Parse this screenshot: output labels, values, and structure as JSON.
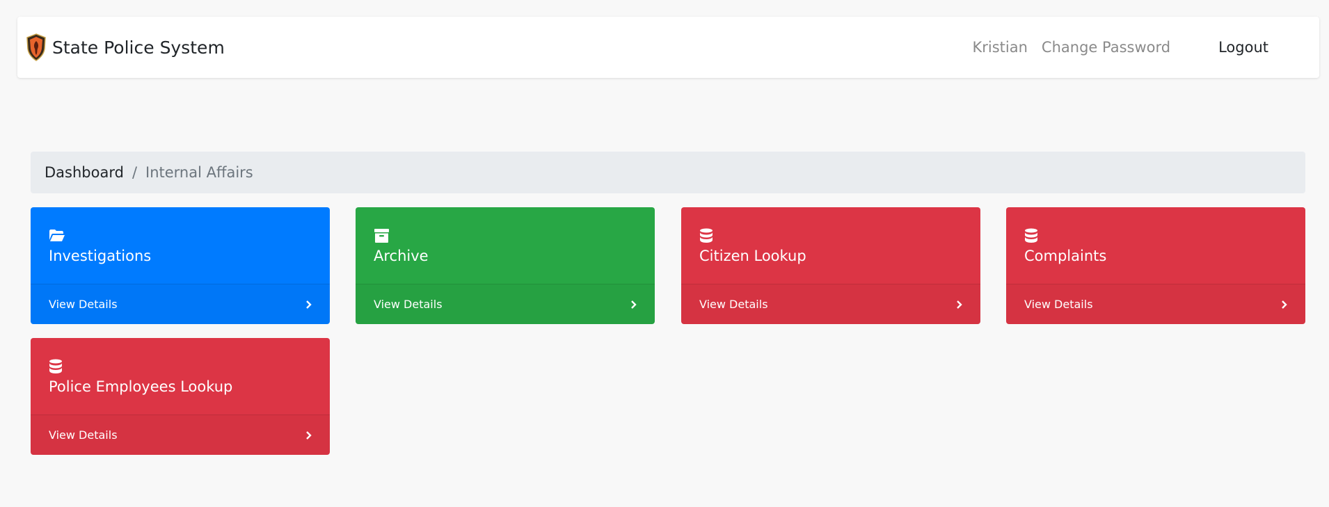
{
  "navbar": {
    "brand_title": "State Police System",
    "user_label": "Kristian",
    "change_password_label": "Change Password",
    "logout_label": "Logout"
  },
  "breadcrumb": {
    "root_label": "Dashboard",
    "separator": "/",
    "current_label": "Internal Affairs"
  },
  "cards": [
    {
      "title": "Investigations",
      "footer_label": "View Details",
      "icon": "folder-open-icon",
      "color": "#007bff"
    },
    {
      "title": "Archive",
      "footer_label": "View Details",
      "icon": "archive-icon",
      "color": "#28a745"
    },
    {
      "title": "Citizen Lookup",
      "footer_label": "View Details",
      "icon": "database-icon",
      "color": "#dc3545"
    },
    {
      "title": "Complaints",
      "footer_label": "View Details",
      "icon": "database-icon",
      "color": "#dc3545"
    },
    {
      "title": "Police Employees Lookup",
      "footer_label": "View Details",
      "icon": "database-icon",
      "color": "#dc3545"
    }
  ],
  "colors": {
    "page_background": "#f8f8f8",
    "primary": "#007bff",
    "success": "#28a745",
    "danger": "#dc3545",
    "breadcrumb_background": "#e9ecef"
  }
}
